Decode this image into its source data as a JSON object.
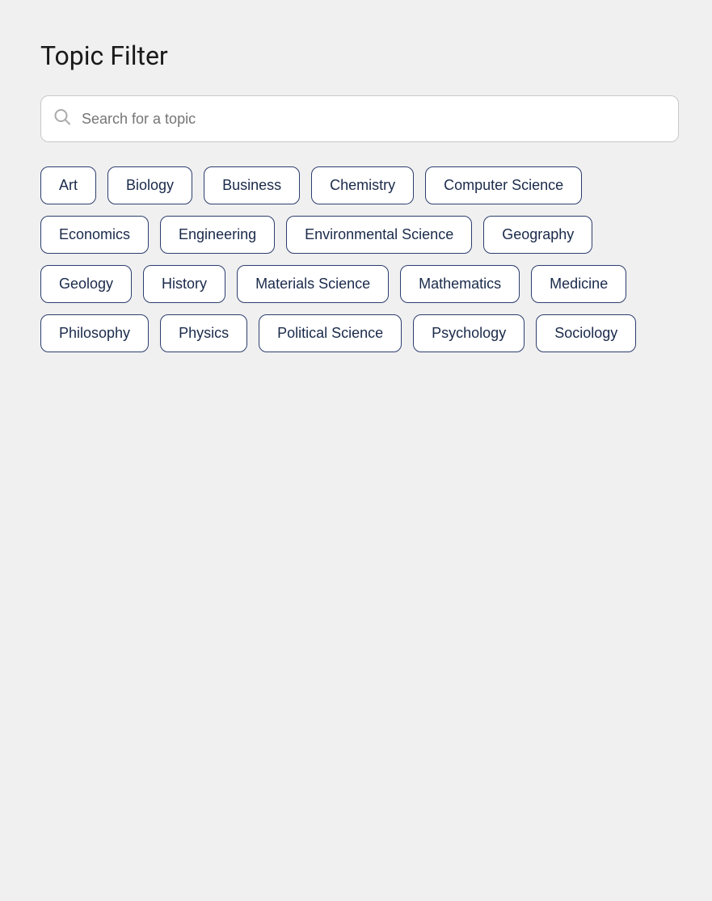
{
  "header": {
    "title": "Topic Filter"
  },
  "search": {
    "placeholder": "Search for a topic",
    "value": ""
  },
  "tags": [
    {
      "id": "art",
      "label": "Art"
    },
    {
      "id": "biology",
      "label": "Biology"
    },
    {
      "id": "business",
      "label": "Business"
    },
    {
      "id": "chemistry",
      "label": "Chemistry"
    },
    {
      "id": "computer-science",
      "label": "Computer Science"
    },
    {
      "id": "economics",
      "label": "Economics"
    },
    {
      "id": "engineering",
      "label": "Engineering"
    },
    {
      "id": "environmental-science",
      "label": "Environmental Science"
    },
    {
      "id": "geography",
      "label": "Geography"
    },
    {
      "id": "geology",
      "label": "Geology"
    },
    {
      "id": "history",
      "label": "History"
    },
    {
      "id": "materials-science",
      "label": "Materials Science"
    },
    {
      "id": "mathematics",
      "label": "Mathematics"
    },
    {
      "id": "medicine",
      "label": "Medicine"
    },
    {
      "id": "philosophy",
      "label": "Philosophy"
    },
    {
      "id": "physics",
      "label": "Physics"
    },
    {
      "id": "political-science",
      "label": "Political Science"
    },
    {
      "id": "psychology",
      "label": "Psychology"
    },
    {
      "id": "sociology",
      "label": "Sociology"
    }
  ]
}
